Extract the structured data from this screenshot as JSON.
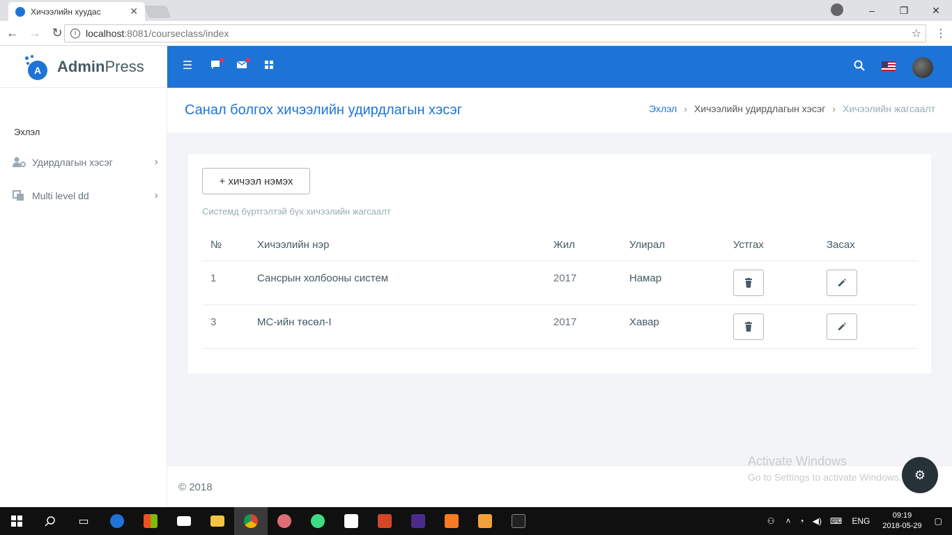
{
  "browser": {
    "tab_title": "Хичээлийн хуудас",
    "url_host": "localhost",
    "url_path": ":8081/courseclass/index"
  },
  "brand": {
    "name_bold": "Admin",
    "name_light": "Press",
    "mark_letter": "A"
  },
  "sidebar": {
    "section": "Эхлэл",
    "items": [
      {
        "label": "Удирдлагын хэсэг",
        "icon": "users-cog-icon"
      },
      {
        "label": "Multi level dd",
        "icon": "copy-icon"
      }
    ]
  },
  "topbar": {
    "icons": [
      "menu-icon",
      "message-icon",
      "mail-icon",
      "grid-icon",
      "search-icon",
      "us-flag-icon",
      "avatar"
    ],
    "accent": "#1e74d6"
  },
  "header": {
    "title": "Санал болгох хичээлийн удирдлагын хэсэг",
    "breadcrumbs": [
      "Эхлэл",
      "Хичээлийн удирдлагын хэсэг",
      "Хичээлийн жагсаалт"
    ]
  },
  "card": {
    "add_button": "+ хичээл нэмэх",
    "subtitle": "Системд бүртгэлтэй бүх хичээлийн жагсаалт",
    "columns": [
      "№",
      "Хичээлийн нэр",
      "Жил",
      "Улирал",
      "Устгах",
      "Засах"
    ],
    "rows": [
      {
        "no": "1",
        "name": "Сансрын холбооны систем",
        "year": "2017",
        "semester": "Намар"
      },
      {
        "no": "3",
        "name": "МС-ийн төсөл-I",
        "year": "2017",
        "semester": "Хавар"
      }
    ]
  },
  "footer": {
    "text": "© 2018"
  },
  "watermark": {
    "line1": "Activate Windows",
    "line2": "Go to Settings to activate Windows."
  },
  "taskbar": {
    "language": "ENG",
    "time": "09:19",
    "date": "2018-05-29"
  }
}
